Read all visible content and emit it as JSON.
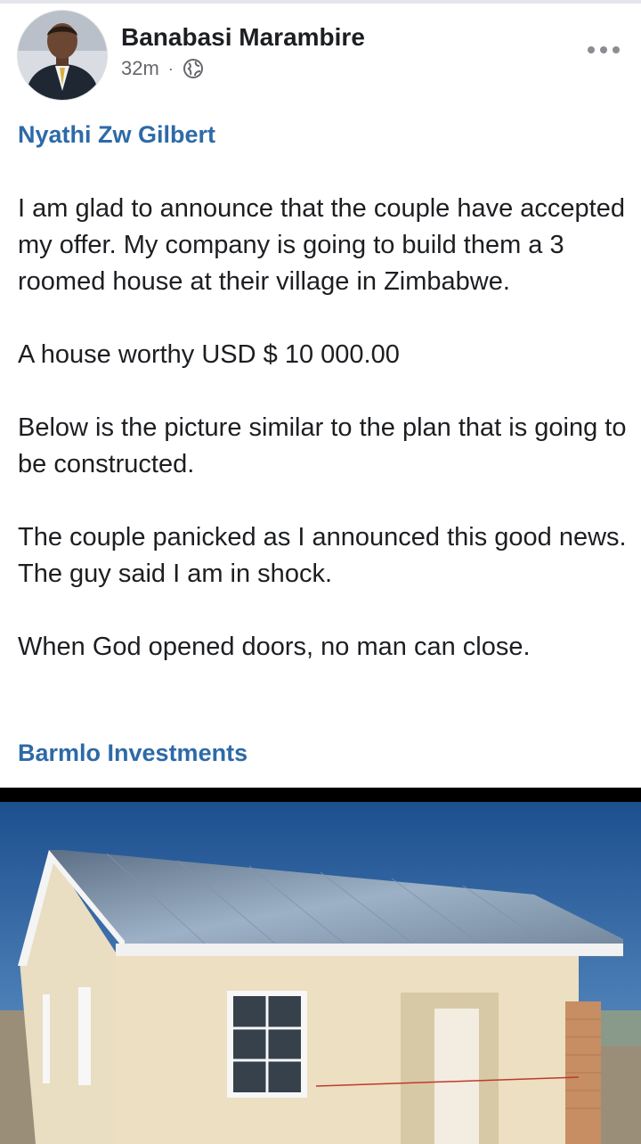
{
  "post": {
    "author": "Banabasi Marambire",
    "time": "32m",
    "separator": "·",
    "audience_icon": "globe-icon",
    "more_icon": "more-options-icon",
    "mention": "Nyathi Zw Gilbert",
    "paragraphs": [
      "I am glad to announce that the couple have accepted my offer. My company is going to build them a 3 roomed house at their village in Zimbabwe.",
      "A house worthy  USD $ 10 000.00",
      "Below is the picture similar to the plan that is going to be constructed.",
      "The couple panicked as I announced this good news. The guy said I am in shock.",
      "When God opened doors, no man can close."
    ],
    "page_link": "Barmlo Investments",
    "photo_subject": "house-with-metal-roof-photo"
  },
  "colors": {
    "link_blue": "#2d6aa7",
    "meta_gray": "#65676b",
    "text": "#1c1e21"
  }
}
